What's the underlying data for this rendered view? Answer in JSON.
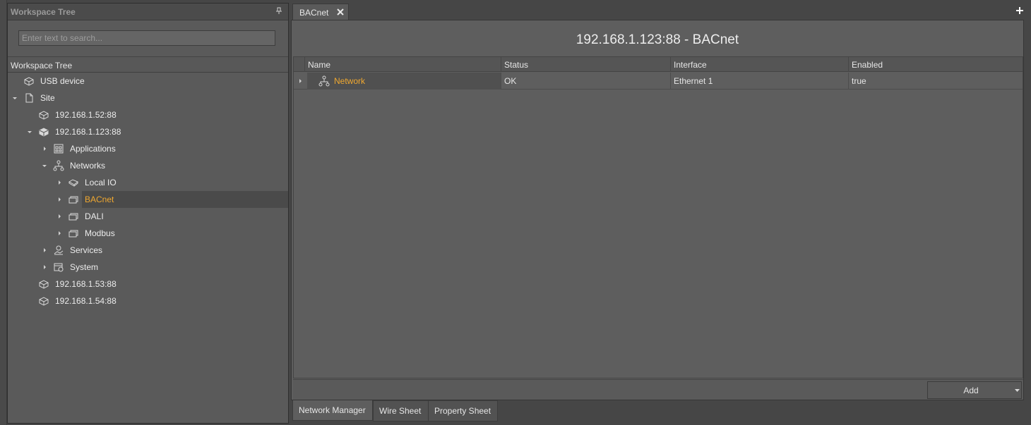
{
  "workspace": {
    "title": "Workspace Tree",
    "search_placeholder": "Enter text to search...",
    "column_label": "Workspace Tree",
    "tree": [
      {
        "label": "USB device",
        "icon": "device-icon"
      },
      {
        "label": "Site",
        "icon": "page-icon"
      },
      {
        "label": "192.168.1.52:88",
        "icon": "device-icon"
      },
      {
        "label": "192.168.1.123:88",
        "icon": "device-active-icon"
      },
      {
        "label": "Applications",
        "icon": "applications-icon"
      },
      {
        "label": "Networks",
        "icon": "network-icon"
      },
      {
        "label": "Local IO",
        "icon": "local-io-icon"
      },
      {
        "label": "BACnet",
        "icon": "protocol-icon"
      },
      {
        "label": "DALI",
        "icon": "protocol-icon"
      },
      {
        "label": "Modbus",
        "icon": "protocol-icon"
      },
      {
        "label": "Services",
        "icon": "services-icon"
      },
      {
        "label": "System",
        "icon": "system-icon"
      },
      {
        "label": "192.168.1.53:88",
        "icon": "device-icon"
      },
      {
        "label": "192.168.1.54:88",
        "icon": "device-icon"
      }
    ]
  },
  "tabs": {
    "active": "BACnet"
  },
  "main": {
    "title": "192.168.1.123:88 - BACnet",
    "columns": [
      "Name",
      "Status",
      "Interface",
      "Enabled"
    ],
    "rows": [
      {
        "name": "Network",
        "status": "OK",
        "interface": "Ethernet 1",
        "enabled": "true"
      }
    ],
    "add_label": "Add"
  },
  "view_tabs": [
    "Network Manager",
    "Wire Sheet",
    "Property Sheet"
  ],
  "colors": {
    "accent": "#f0a830",
    "panel": "#5a5a5a",
    "background": "#464646"
  }
}
